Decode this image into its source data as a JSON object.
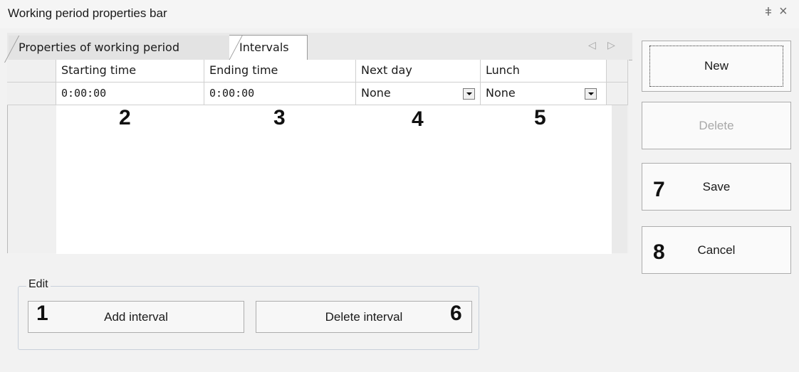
{
  "window": {
    "title": "Working period properties bar",
    "pin_icon": "pin-icon",
    "close_icon": "close-icon"
  },
  "tabs": [
    {
      "label": "Properties of working period",
      "active": false
    },
    {
      "label": "Intervals",
      "active": true
    }
  ],
  "grid": {
    "columns": [
      "Starting time",
      "Ending time",
      "Next day",
      "Lunch"
    ],
    "rows": [
      {
        "start": "0:00:00",
        "end": "0:00:00",
        "next_day": "None",
        "lunch": "None"
      }
    ]
  },
  "markers": {
    "add_interval": "1",
    "starting_time": "2",
    "ending_time": "3",
    "next_day": "4",
    "lunch": "5",
    "delete_interval": "6",
    "save": "7",
    "cancel": "8"
  },
  "side_buttons": {
    "new": "New",
    "delete": "Delete",
    "save": "Save",
    "cancel": "Cancel"
  },
  "edit": {
    "legend": "Edit",
    "add_interval": "Add interval",
    "delete_interval": "Delete interval"
  },
  "colors": {
    "disabled_text": "#a8a8a8",
    "grid_bg": "#ffffff",
    "panel_bg": "#f2f2f2"
  }
}
